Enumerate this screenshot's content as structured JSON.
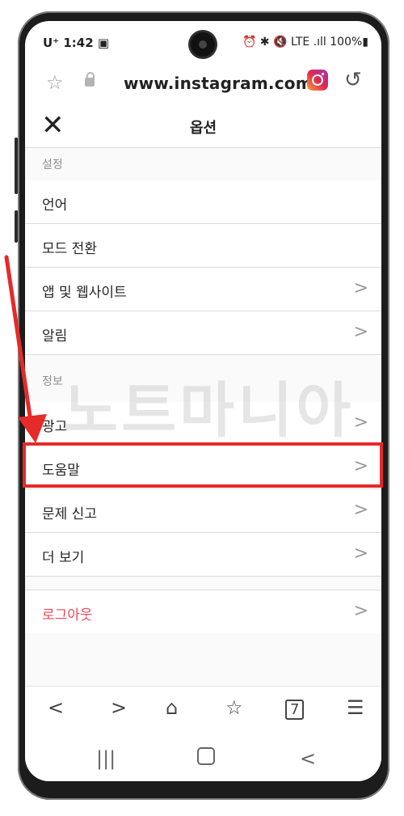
{
  "status_bar": {
    "left": "U⁺ 1:42 ▣",
    "right": "⏰ ✱ 🔇 LTE .ıll 100%▮"
  },
  "browser": {
    "url": "www.instagram.com"
  },
  "page": {
    "title": "옵션"
  },
  "sections": [
    {
      "header": "설정",
      "items": [
        "언어",
        "모드 전환",
        "앱 및 웹사이트",
        "알림"
      ]
    },
    {
      "header": "정보",
      "items": [
        "광고",
        "도움말",
        "문제 신고",
        "더 보기"
      ]
    }
  ],
  "logout": "로그아웃",
  "watermark": "노트마니아",
  "accent_color": "#e52a2a",
  "logout_color": "#ed4956"
}
